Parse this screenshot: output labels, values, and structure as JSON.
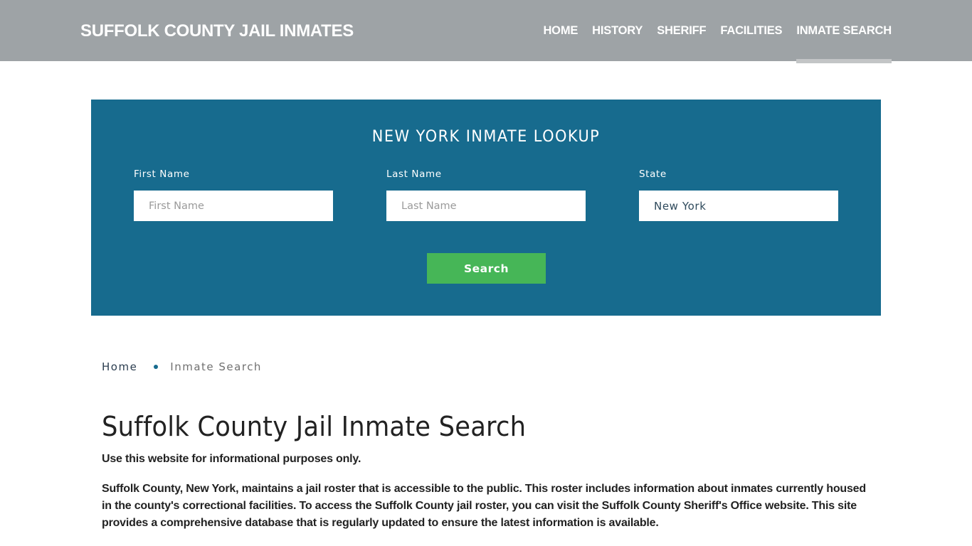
{
  "header": {
    "site_title": "SUFFOLK COUNTY JAIL INMATES",
    "nav": [
      {
        "label": "HOME"
      },
      {
        "label": "HISTORY"
      },
      {
        "label": "SHERIFF"
      },
      {
        "label": "FACILITIES"
      },
      {
        "label": "INMATE SEARCH",
        "active": true
      }
    ]
  },
  "lookup": {
    "title": "NEW YORK INMATE LOOKUP",
    "first_name": {
      "label": "First Name",
      "placeholder": "First Name",
      "value": ""
    },
    "last_name": {
      "label": "Last Name",
      "placeholder": "Last Name",
      "value": ""
    },
    "state": {
      "label": "State",
      "value": "New York"
    },
    "search_label": "Search"
  },
  "breadcrumb": {
    "home": "Home",
    "current": "Inmate Search"
  },
  "content": {
    "title": "Suffolk County Jail Inmate Search",
    "disclaimer": "Use this website for informational purposes only.",
    "intro": "Suffolk County, New York, maintains a jail roster that is accessible to the public. This roster includes information about inmates currently housed in the county's correctional facilities. To access the Suffolk County jail roster, you can visit the Suffolk County Sheriff's Office website. This site provides a comprehensive database that is regularly updated to ensure the latest information is available."
  },
  "colors": {
    "header_bg": "#9ea3a6",
    "lookup_bg": "#176b8e",
    "search_button": "#46b657",
    "active_underline": "#c3c5c6"
  }
}
